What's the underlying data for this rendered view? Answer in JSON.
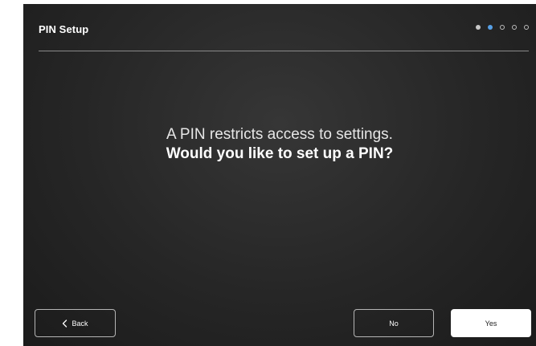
{
  "header": {
    "title": "PIN Setup",
    "steps": [
      "done",
      "current",
      "todo",
      "todo",
      "todo"
    ]
  },
  "message": {
    "line1": "A PIN restricts access to settings.",
    "line2": "Would you like to set up a PIN?"
  },
  "footer": {
    "back_label": "Back",
    "no_label": "No",
    "yes_label": "Yes"
  },
  "colors": {
    "accent": "#57a0e6",
    "background": "#262626"
  },
  "icons": {
    "back": "chevron-left-icon"
  }
}
